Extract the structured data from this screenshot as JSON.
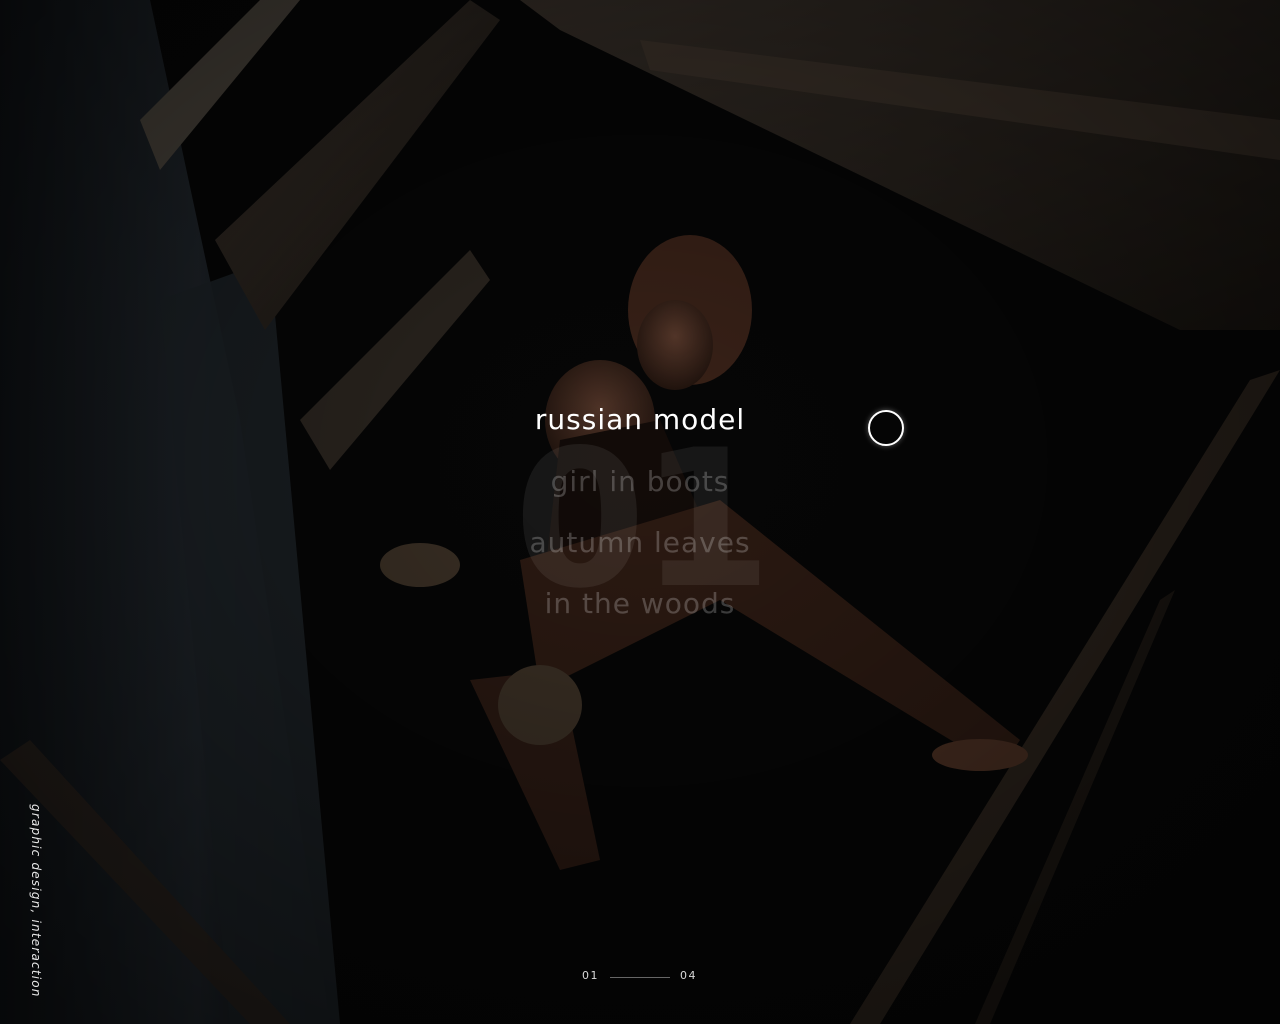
{
  "menu": {
    "items": [
      {
        "label": "russian model",
        "active": true
      },
      {
        "label": "girl in boots",
        "active": false
      },
      {
        "label": "autumn leaves",
        "active": false
      },
      {
        "label": "in the woods",
        "active": false
      }
    ],
    "index_watermark": "01"
  },
  "tagline": "graphic design, interaction",
  "pager": {
    "current": "01",
    "total": "04"
  },
  "colors": {
    "active_text": "#ffffff",
    "inactive_text": "rgba(255,255,255,0.22)",
    "background": "#050505"
  }
}
